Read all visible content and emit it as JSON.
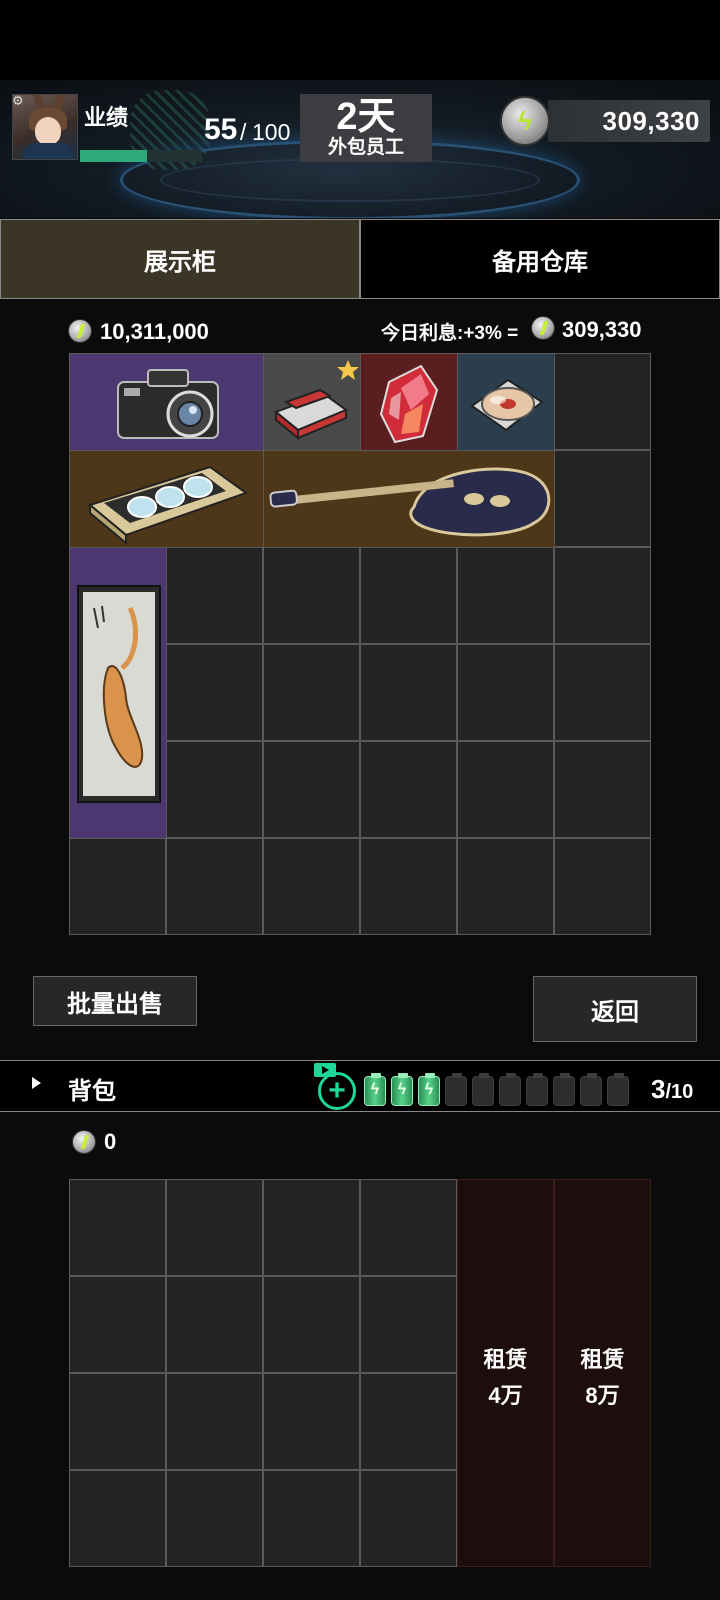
{
  "header": {
    "performance_label": "业绩",
    "performance_current": "55",
    "performance_separator": "/",
    "performance_max": "100",
    "performance_fraction": 0.55,
    "days_value": "2天",
    "days_sub": "外包员工",
    "coins": "309,330"
  },
  "tabs": {
    "showcase": "展示柜",
    "storage": "备用仓库",
    "active": "showcase"
  },
  "showcase": {
    "total_value": "10,311,000",
    "interest_label": "今日利息:+3% =",
    "interest_value": "309,330",
    "items": [
      {
        "name": "camera",
        "rarity": "purple"
      },
      {
        "name": "cigarette-pack",
        "rarity": "gray",
        "starred": true
      },
      {
        "name": "red-crystal",
        "rarity": "red"
      },
      {
        "name": "cd-disc",
        "rarity": "blue"
      },
      {
        "name": "cassette-tape",
        "rarity": "brown"
      },
      {
        "name": "electric-guitar",
        "rarity": "brown"
      },
      {
        "name": "tiger-scroll-painting",
        "rarity": "purple"
      }
    ]
  },
  "buttons": {
    "bulk_sell": "批量出售",
    "back": "返回"
  },
  "backpack": {
    "label": "背包",
    "coins": "0",
    "batteries_filled": 3,
    "batteries_total": 10,
    "battery_count_current": "3",
    "battery_count_total": "/10",
    "rent": [
      {
        "label": "租赁",
        "price": "4万"
      },
      {
        "label": "租赁",
        "price": "8万"
      }
    ]
  },
  "colors": {
    "accent_green": "#1fd69b",
    "rarity_purple": "#4c3770",
    "rarity_gray": "#4a4a4a",
    "rarity_red": "#5a1e1e",
    "rarity_blue": "#2a3e4e",
    "rarity_brown": "#4e3618",
    "tab_active": "#3a3526"
  }
}
